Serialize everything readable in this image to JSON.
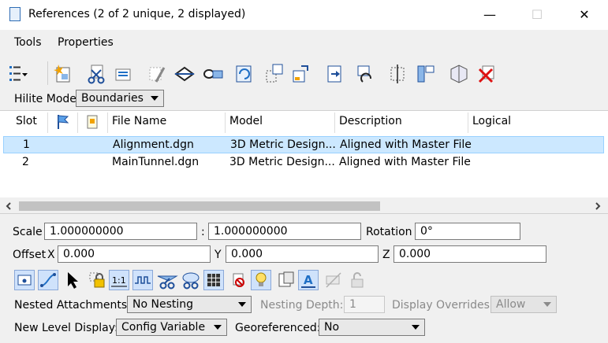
{
  "window": {
    "title": "References (2 of 2 unique, 2 displayed)",
    "minimize_glyph": "—",
    "maximize_glyph": "☐",
    "close_glyph": "✕"
  },
  "menu": {
    "tools": "Tools",
    "properties": "Properties"
  },
  "toolbar": {
    "icons": [
      "list-view-icon",
      "attach-reference-icon",
      "detach-reference-icon",
      "reload-reference-icon",
      "exchange-reference-icon",
      "move-reference-icon",
      "copy-reference-icon",
      "scale-reference-icon",
      "rotate-reference-icon",
      "mirror-horizontal-icon",
      "mirror-vertical-icon",
      "clip-boundary-icon",
      "clip-mask-icon",
      "clip-front-icon",
      "clip-back-icon",
      "delete-clip-icon",
      "set-display-depth-icon",
      "make-direct-attachment-icon",
      "delete-reference-icon"
    ]
  },
  "hilite": {
    "label": "Hilite Mode:",
    "value": "Boundaries"
  },
  "grid": {
    "headers": {
      "slot": "Slot",
      "file_name": "File Name",
      "model": "Model",
      "description": "Description",
      "logical": "Logical"
    },
    "rows": [
      {
        "slot": "1",
        "file": "Alignment.dgn",
        "model": "3D Metric Design...",
        "description": "Aligned with Master File",
        "logical": ""
      },
      {
        "slot": "2",
        "file": "MainTunnel.dgn",
        "model": "3D Metric Design...",
        "description": "Aligned with Master File",
        "logical": ""
      }
    ]
  },
  "scale": {
    "label": "Scale",
    "value1": "1.000000000",
    "separator": ":",
    "value2": "1.000000000",
    "rotation_label": "Rotation",
    "rotation_value": "0°"
  },
  "offset": {
    "label": "Offset",
    "x_label": "X",
    "x_value": "0.000",
    "y_label": "Y",
    "y_value": "0.000",
    "z_label": "Z",
    "z_value": "0.000"
  },
  "nested": {
    "label": "Nested Attachments:",
    "value": "No Nesting",
    "depth_label": "Nesting Depth:",
    "depth_value": "1",
    "overrides_label": "Display Overrides:",
    "overrides_value": "Allow"
  },
  "level": {
    "label": "New Level Display:",
    "value": "Config Variable",
    "geo_label": "Georeferenced:",
    "geo_value": "No"
  },
  "colors": {
    "selection": "#cce8ff",
    "toggle_on": "#cfe2fb",
    "accent_blue": "#1f6fc5"
  }
}
